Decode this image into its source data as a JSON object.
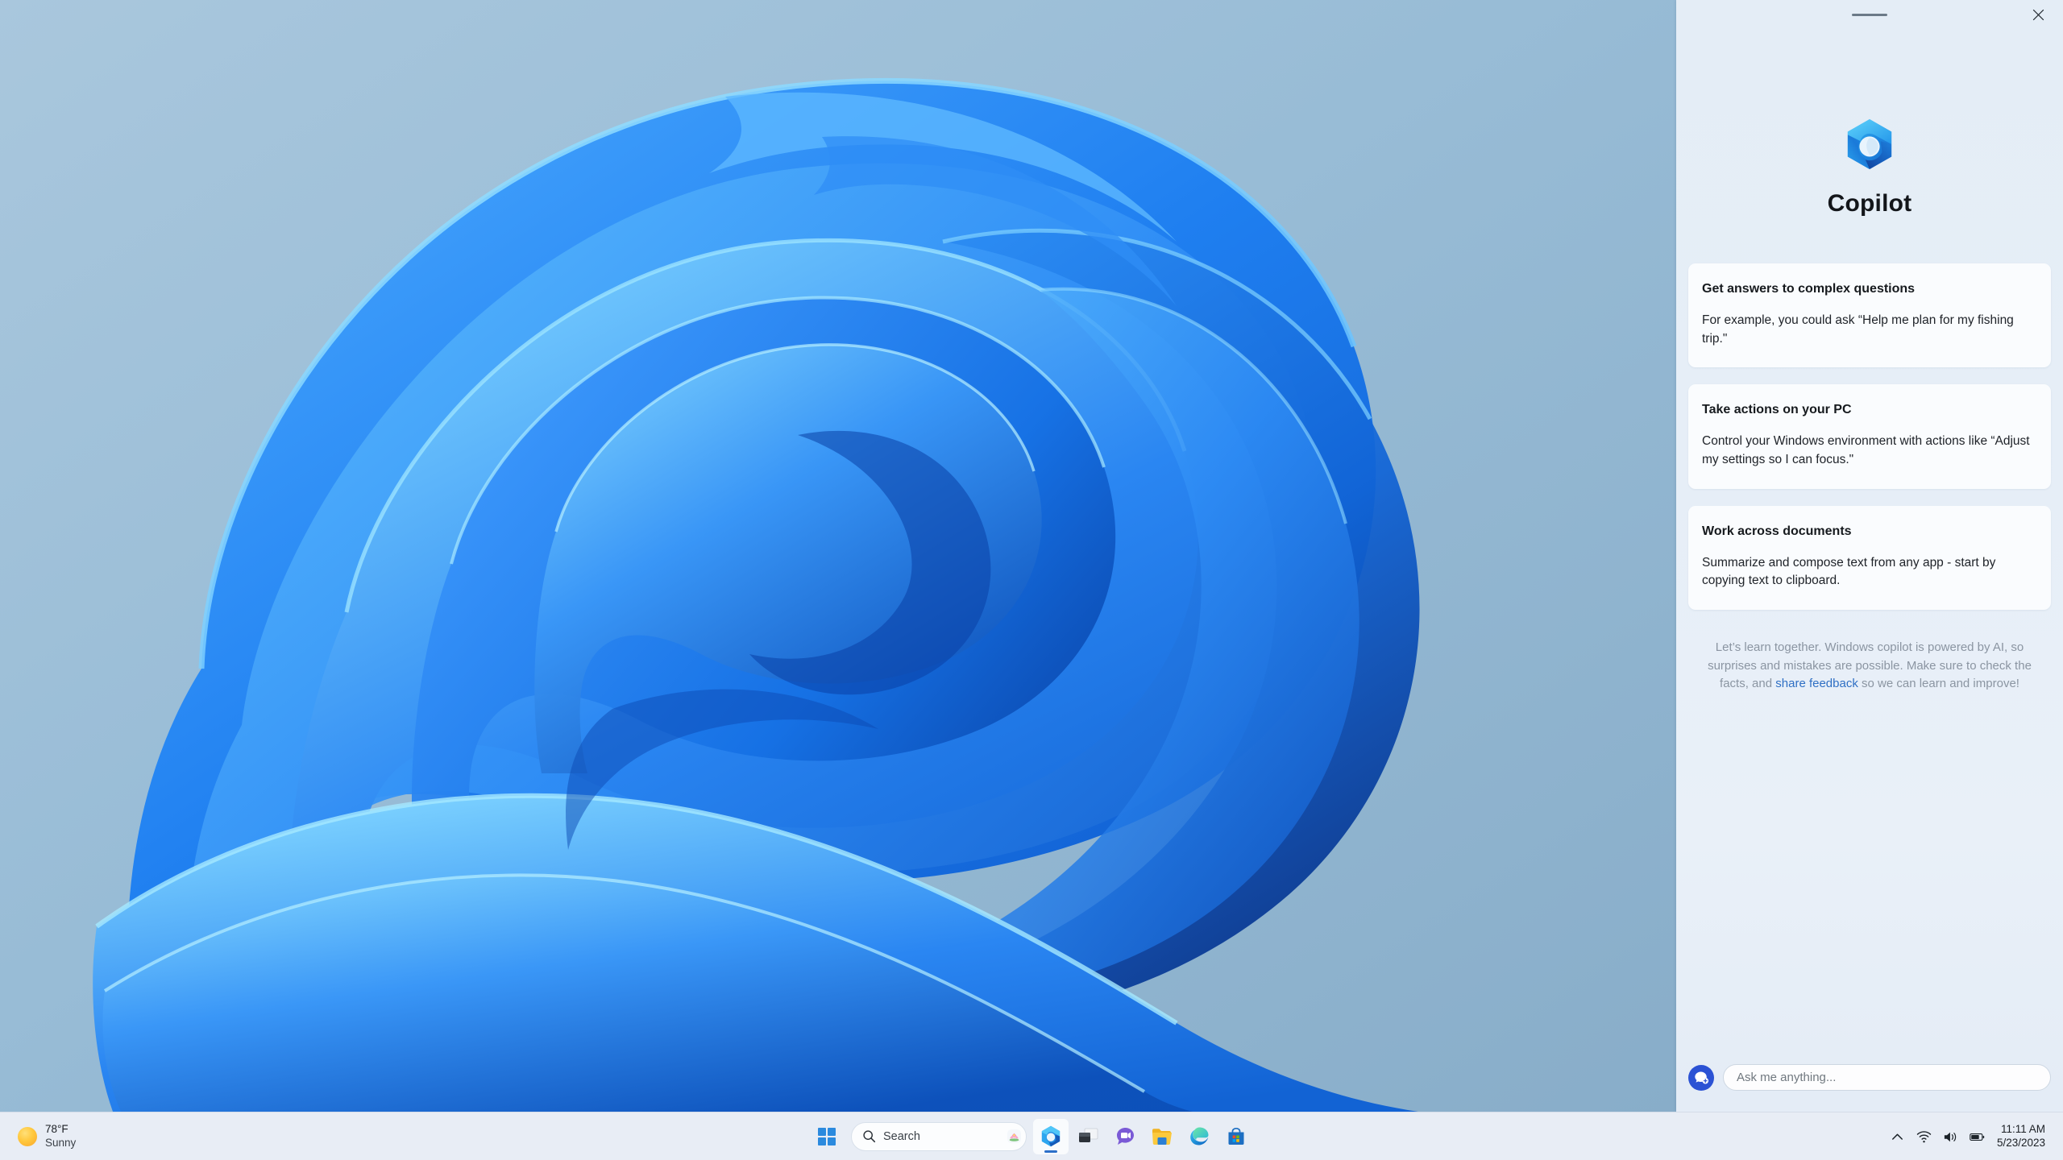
{
  "desktop": {
    "wallpaper_name": "windows-11-bloom-wallpaper",
    "background_color": "#8fb4d1"
  },
  "copilot": {
    "titlebar": {
      "drag_handle_name": "drag-handle",
      "close_label": "Close"
    },
    "brand": {
      "logo_name": "copilot-logo",
      "title": "Copilot"
    },
    "cards": [
      {
        "title": "Get answers to complex questions",
        "body": "For example, you could ask “Help me plan for my fishing trip.\""
      },
      {
        "title": "Take actions on your PC",
        "body": "Control your Windows environment with actions like “Adjust my settings so I can focus.\""
      },
      {
        "title": "Work across documents",
        "body": "Summarize and compose text from any app - start by copying text to clipboard."
      }
    ],
    "disclaimer": {
      "text_before": "Let’s learn together. Windows copilot is powered by AI, so surprises and mistakes are possible. Make sure to check the facts, and ",
      "link": "share feedback",
      "text_after": " so we can learn and improve!",
      "link_color": "#2f6fc4"
    },
    "composer": {
      "new_topic_icon": "new-topic-icon",
      "input_placeholder": "Ask me anything...",
      "input_value": "",
      "button_color": "#2b52d4"
    },
    "panel_background": "#e6eef7"
  },
  "taskbar": {
    "weather": {
      "icon": "sun-icon",
      "temperature": "78°F",
      "condition": "Sunny"
    },
    "start": {
      "label": "Start",
      "icon": "windows-logo-icon"
    },
    "search": {
      "icon": "search-icon",
      "label": "Search",
      "badge_icon": "lotus-flower-icon"
    },
    "apps": [
      {
        "name": "copilot",
        "label": "Copilot",
        "active": true
      },
      {
        "name": "task-view",
        "label": "Task View",
        "active": false
      },
      {
        "name": "chat",
        "label": "Chat",
        "active": false
      },
      {
        "name": "file-explorer",
        "label": "File Explorer",
        "active": false
      },
      {
        "name": "edge",
        "label": "Microsoft Edge",
        "active": false
      },
      {
        "name": "microsoft-store",
        "label": "Microsoft Store",
        "active": false
      }
    ],
    "tray": {
      "show_hidden_icons": "chevron-up-icon",
      "network": "wifi-icon",
      "volume": "speaker-icon",
      "battery": "battery-icon",
      "time": "11:11 AM",
      "date": "5/23/2023"
    },
    "background_color": "#e8edf5"
  }
}
